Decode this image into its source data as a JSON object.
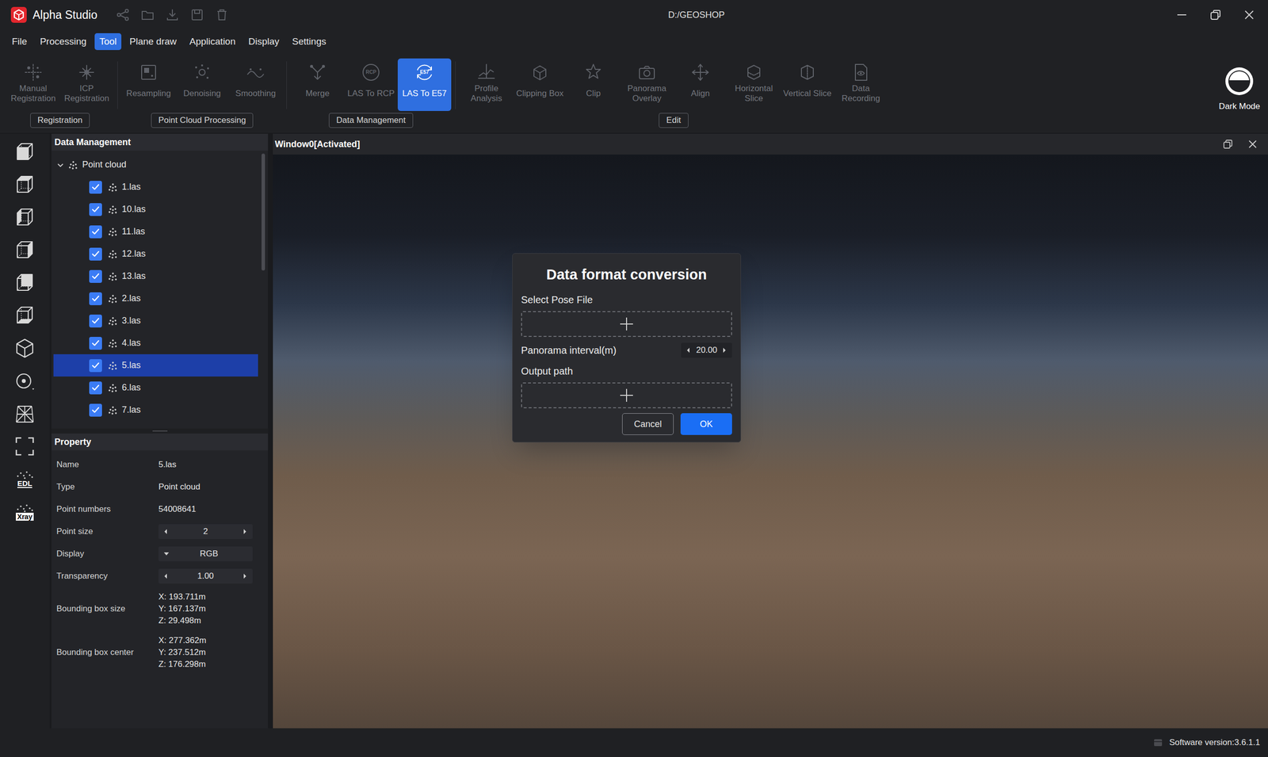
{
  "app": {
    "title": "Alpha Studio",
    "path": "D:/GEOSHOP"
  },
  "menu": [
    {
      "label": "File",
      "selected": false
    },
    {
      "label": "Processing",
      "selected": false
    },
    {
      "label": "Tool",
      "selected": true
    },
    {
      "label": "Plane draw",
      "selected": false
    },
    {
      "label": "Application",
      "selected": false
    },
    {
      "label": "Display",
      "selected": false
    },
    {
      "label": "Settings",
      "selected": false
    }
  ],
  "toolbar": {
    "groups": [
      {
        "label": "Registration",
        "tools": [
          {
            "label": "Manual Registration",
            "disabled": true,
            "selected": false
          },
          {
            "label": "ICP Registration",
            "disabled": true,
            "selected": false
          }
        ]
      },
      {
        "label": "Point Cloud Processing",
        "tools": [
          {
            "label": "Resampling",
            "disabled": true,
            "selected": false
          },
          {
            "label": "Denoising",
            "disabled": true,
            "selected": false
          },
          {
            "label": "Smoothing",
            "disabled": true,
            "selected": false
          }
        ]
      },
      {
        "label": "Data Management",
        "tools": [
          {
            "label": "Merge",
            "disabled": true,
            "selected": false
          },
          {
            "label": "LAS To RCP",
            "icon_text": "RCP",
            "disabled": true,
            "selected": false
          },
          {
            "label": "LAS To E57",
            "icon_text": "E57",
            "disabled": false,
            "selected": true
          }
        ]
      },
      {
        "label": "Edit",
        "tools": [
          {
            "label": "Profile Analysis",
            "disabled": true,
            "selected": false
          },
          {
            "label": "Clipping Box",
            "disabled": true,
            "selected": false
          },
          {
            "label": "Clip",
            "disabled": true,
            "selected": false
          },
          {
            "label": "Panorama Overlay",
            "disabled": true,
            "selected": false
          },
          {
            "label": "Align",
            "disabled": true,
            "selected": false
          },
          {
            "label": "Horizontal Slice",
            "disabled": true,
            "selected": false
          },
          {
            "label": "Vertical Slice",
            "disabled": true,
            "selected": false
          },
          {
            "label": "Data Recording",
            "disabled": true,
            "selected": false
          }
        ]
      }
    ]
  },
  "dark_mode": {
    "label": "Dark Mode"
  },
  "view_toggles": [
    {
      "text": "EDL"
    },
    {
      "text": "Xray"
    }
  ],
  "data_panel": {
    "title": "Data Management",
    "root": {
      "label": "Point cloud",
      "expanded": true
    },
    "items": [
      {
        "label": "1.las",
        "checked": true,
        "selected": false
      },
      {
        "label": "10.las",
        "checked": true,
        "selected": false
      },
      {
        "label": "11.las",
        "checked": true,
        "selected": false
      },
      {
        "label": "12.las",
        "checked": true,
        "selected": false
      },
      {
        "label": "13.las",
        "checked": true,
        "selected": false
      },
      {
        "label": "2.las",
        "checked": true,
        "selected": false
      },
      {
        "label": "3.las",
        "checked": true,
        "selected": false
      },
      {
        "label": "4.las",
        "checked": true,
        "selected": false
      },
      {
        "label": "5.las",
        "checked": true,
        "selected": true
      },
      {
        "label": "6.las",
        "checked": true,
        "selected": false
      },
      {
        "label": "7.las",
        "checked": true,
        "selected": false
      }
    ],
    "scroll_level": 0.43
  },
  "property": {
    "title": "Property",
    "rows": [
      {
        "label": "Name",
        "kind": "text",
        "values": [
          "5.las"
        ]
      },
      {
        "label": "Type",
        "kind": "text",
        "values": [
          "Point cloud"
        ]
      },
      {
        "label": "Point numbers",
        "kind": "text",
        "values": [
          "54008641"
        ]
      },
      {
        "label": "Point size",
        "kind": "stepper",
        "values": [
          "2"
        ]
      },
      {
        "label": "Display",
        "kind": "dropdown",
        "values": [
          "RGB"
        ]
      },
      {
        "label": "Transparency",
        "kind": "stepper",
        "values": [
          "1.00"
        ]
      },
      {
        "label": "Bounding box size",
        "kind": "multi",
        "values": [
          "X: 193.711m",
          "Y: 167.137m",
          "Z: 29.498m"
        ]
      },
      {
        "label": "Bounding box center",
        "kind": "multi",
        "values": [
          "X: 277.362m",
          "Y: 237.512m",
          "Z: 176.298m"
        ]
      }
    ]
  },
  "viewport": {
    "title": "Window0[Activated]"
  },
  "dialog": {
    "title": "Data format conversion",
    "sections": [
      {
        "kind": "file",
        "label": "Select Pose File"
      },
      {
        "kind": "stepper",
        "label": "Panorama interval(m)",
        "value": "20.00"
      },
      {
        "kind": "file",
        "label": "Output path"
      }
    ],
    "buttons": [
      {
        "label": "Cancel",
        "primary": false
      },
      {
        "label": "OK",
        "primary": true
      }
    ]
  },
  "status_bar": {
    "version": "Software version:3.6.1.1"
  }
}
